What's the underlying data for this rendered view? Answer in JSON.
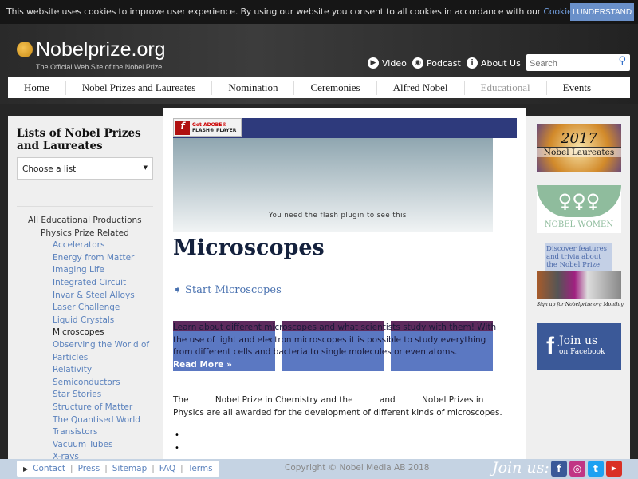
{
  "cookie": {
    "text": "This website uses cookies to improve user experience. By using our website you consent to all cookies in accordance with our ",
    "link": "Cookie Policy",
    "period": ".",
    "button": "I UNDERSTAND"
  },
  "header": {
    "logo": "Nobelprize.org",
    "tagline": "The Official Web Site of the Nobel Prize",
    "video": "Video",
    "podcast": "Podcast",
    "about": "About Us",
    "search_placeholder": "Search"
  },
  "nav": [
    "Home",
    "Nobel Prizes and Laureates",
    "Nomination",
    "Ceremonies",
    "Alfred Nobel",
    "Educational",
    "Events"
  ],
  "sidebar": {
    "title": "Lists of Nobel Prizes and Laureates",
    "select": "Choose a list",
    "l0": "All Educational Productions",
    "l1": "Physics Prize Related",
    "items": [
      "Accelerators",
      "Energy from Matter",
      "Imaging Life",
      "Integrated Circuit",
      "Invar & Steel Alloys",
      "Laser Challenge",
      "Liquid Crystals",
      "Microscopes",
      "Observing the World of",
      "Particles",
      "Relativity",
      "Semiconductors",
      "Star Stories",
      "Structure of Matter",
      "The Quantised World",
      "Transistors",
      "Vacuum Tubes",
      "X-rays"
    ]
  },
  "main": {
    "flash_get": "Get ADOBE®",
    "flash_player": "FLASH® PLAYER",
    "flash_msg": "You need the flash plugin to see this",
    "title": "Microscopes",
    "start": "Start Microscopes",
    "intro": "Learn about different microscopes and what scientists study with them! With the use of light and electron microscopes it is possible to study everything from different cells and bacteria to single molecules or even atoms.",
    "read_more": "Read More »",
    "para": "The          Nobel Prize in Chemistry and the          and          Nobel Prizes in Physics are all awarded for the development of different kinds of microscopes."
  },
  "right": {
    "year": "2017",
    "laureates": "Nobel Laureates",
    "women": "NOBEL WOMEN",
    "discover": "Discover features and trivia about the Nobel Prize",
    "signup": "Sign up for Nobelprize.org Monthly",
    "fb_join": "Join us",
    "fb_on": "on Facebook"
  },
  "footer": {
    "links": [
      "Contact",
      "Press",
      "Sitemap",
      "FAQ",
      "Terms"
    ],
    "copyright": "Copyright © Nobel Media AB 2018",
    "join": "Join us:"
  }
}
